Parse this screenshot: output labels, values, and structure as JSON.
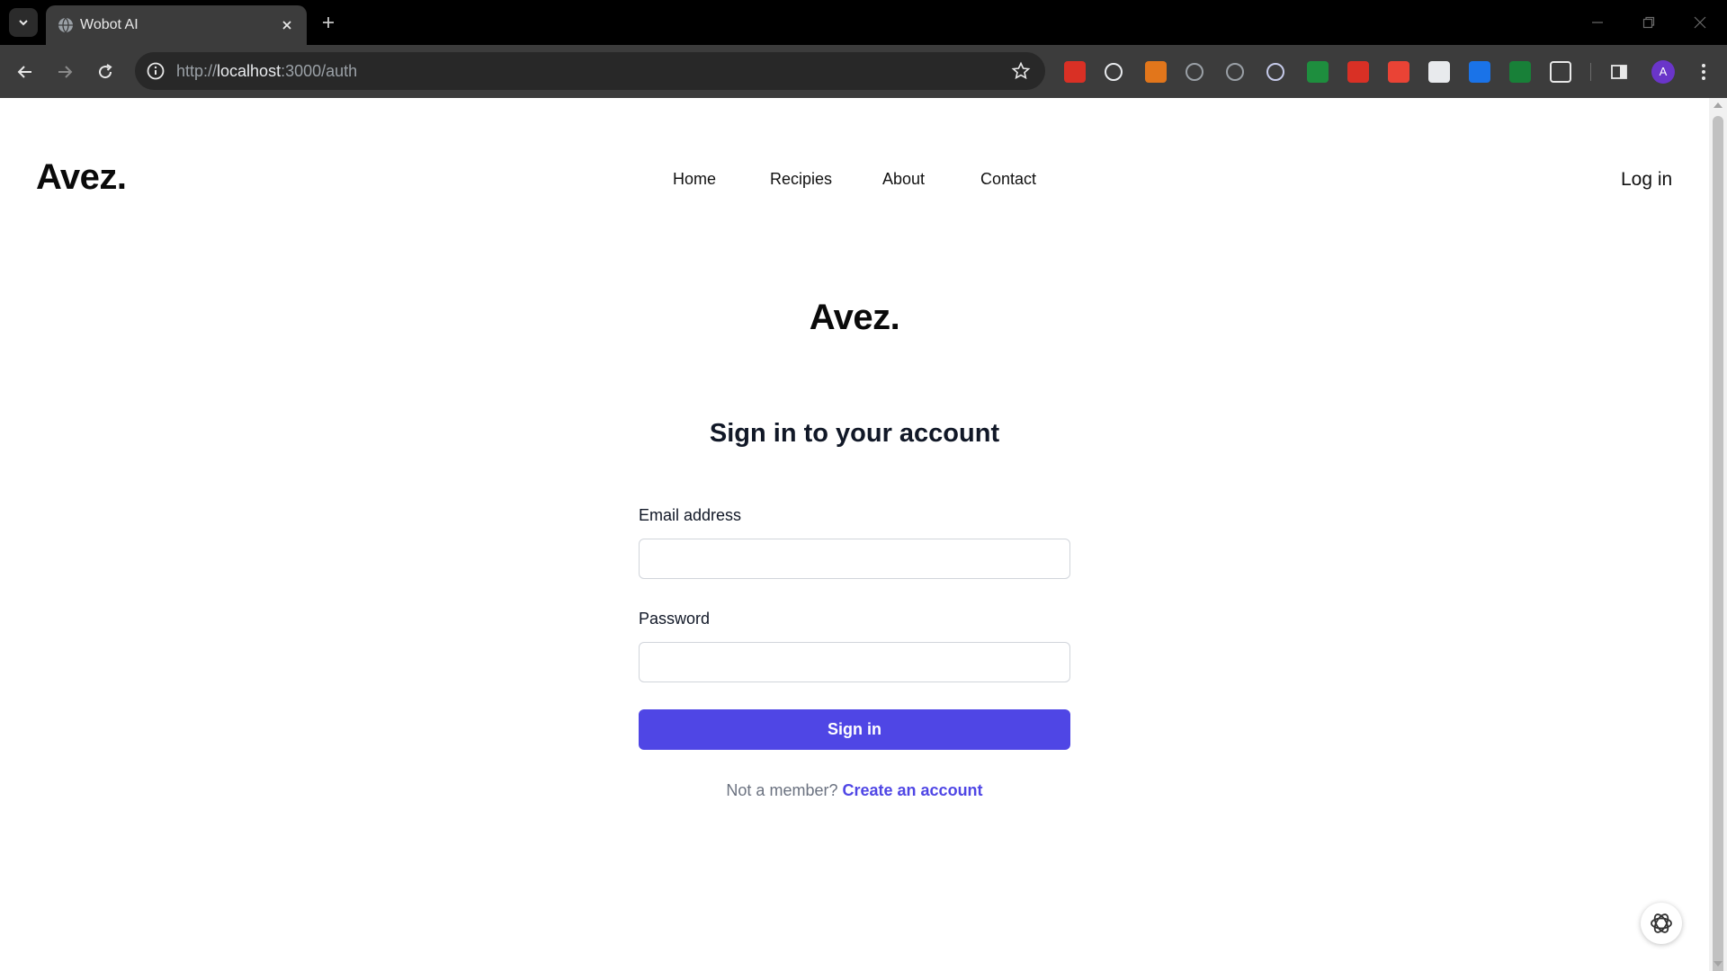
{
  "browser": {
    "tab_title": "Wobot AI",
    "url_scheme": "http://",
    "url_host": "localhost",
    "url_rest": ":3000/auth",
    "profile_initial": "A"
  },
  "extensions": [
    {
      "icon": "extension-red-icon",
      "color": "#d93025"
    },
    {
      "icon": "extension-target-icon",
      "color": "#e8eaed"
    },
    {
      "icon": "metamask-fox-icon",
      "color": "#e2761b"
    },
    {
      "icon": "extension-brackets-icon",
      "color": "#9aa0a6"
    },
    {
      "icon": "extension-timer-icon",
      "color": "#9aa0a6"
    },
    {
      "icon": "extension-shield-icon",
      "color": "#c5cae9"
    },
    {
      "icon": "extension-play-green-icon",
      "color": "#1e8e3e"
    },
    {
      "icon": "extension-play-red-icon",
      "color": "#d93025"
    },
    {
      "icon": "extension-hand-icon",
      "color": "#ea4335"
    },
    {
      "icon": "extension-t-icon",
      "color": "#e8eaed"
    },
    {
      "icon": "extension-f-icon",
      "color": "#1a73e8"
    },
    {
      "icon": "extension-sheet-icon",
      "color": "#188038"
    }
  ],
  "site": {
    "brand": "Avez.",
    "nav": [
      "Home",
      "Recipies",
      "About",
      "Contact"
    ],
    "login_label": "Log in"
  },
  "form": {
    "logo": "Avez.",
    "title": "Sign in to your account",
    "email_label": "Email address",
    "email_value": "",
    "password_label": "Password",
    "password_value": "",
    "submit_label": "Sign in",
    "member_text": "Not a member?",
    "create_link": "Create an account"
  },
  "colors": {
    "primary": "#4f46e5",
    "chrome_dark": "#000000",
    "toolbar": "#3c3c3c"
  }
}
